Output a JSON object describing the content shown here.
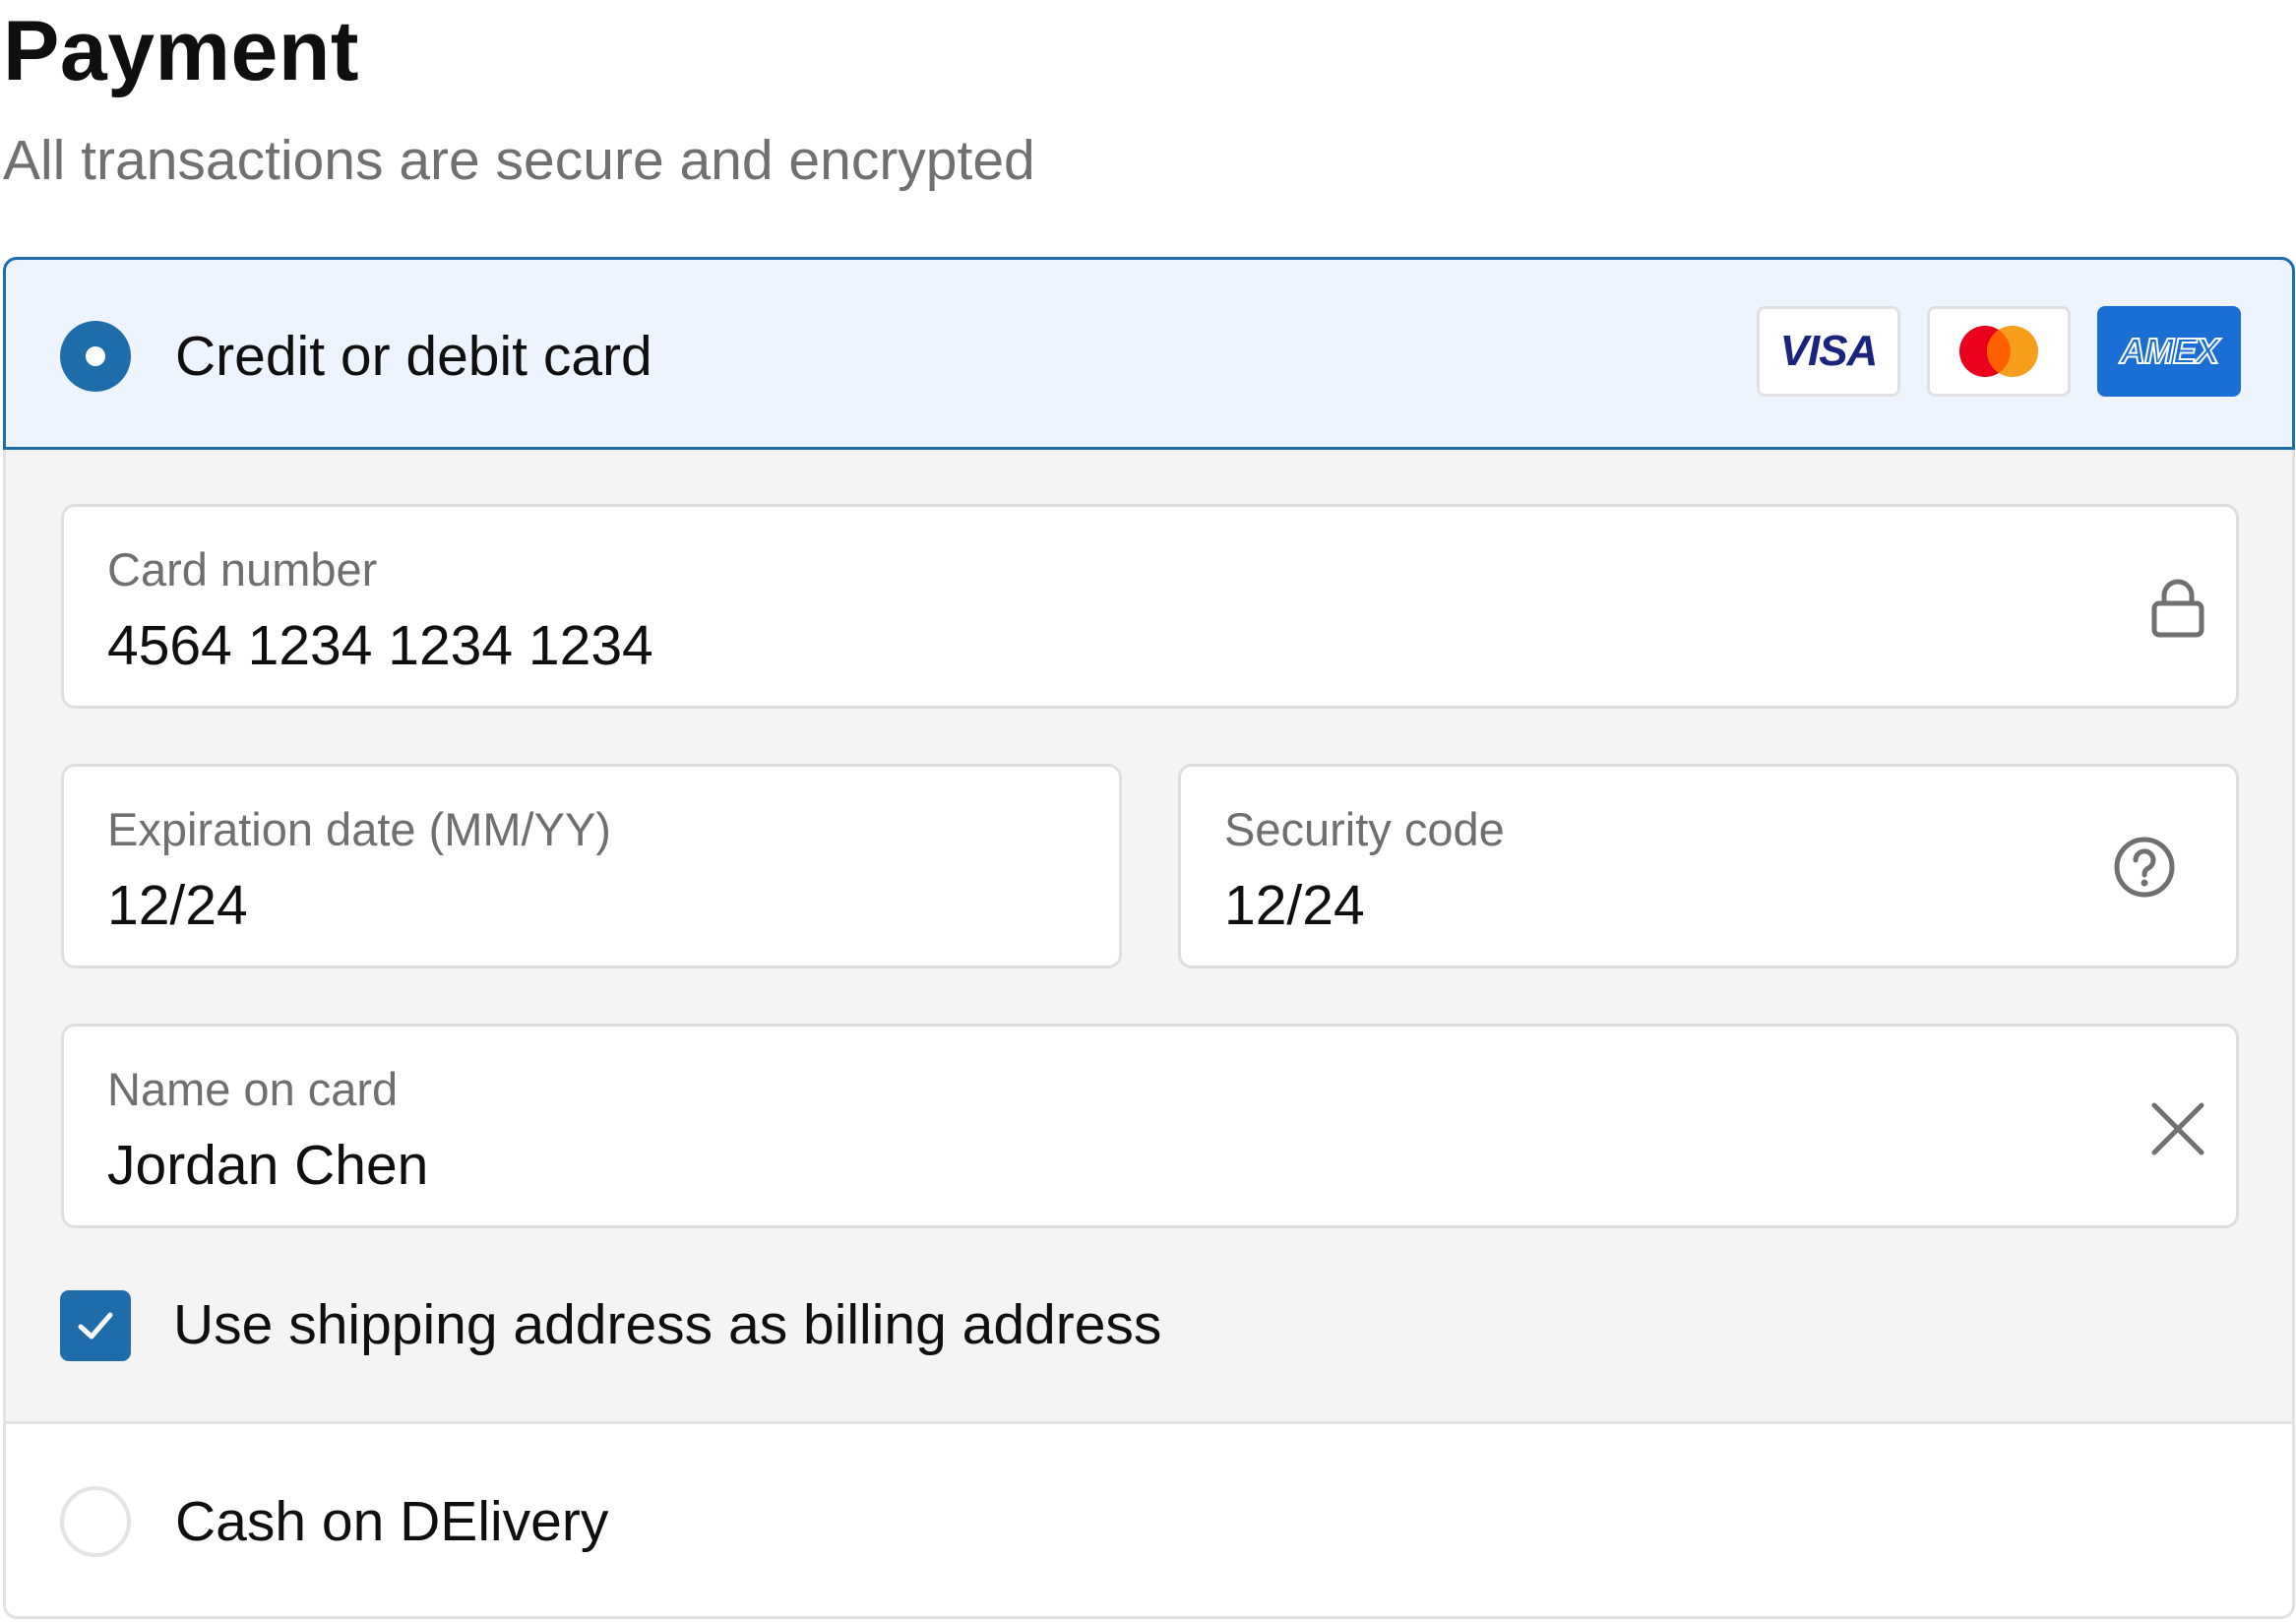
{
  "header": {
    "title": "Payment",
    "subtitle": "All transactions are secure and encrypted"
  },
  "payment_options": [
    {
      "label": "Credit or debit card",
      "selected": true,
      "brands": [
        "VISA",
        "mastercard",
        "AMEX"
      ]
    },
    {
      "label": "Cash on DElivery",
      "selected": false
    }
  ],
  "card_form": {
    "card_number": {
      "label": "Card number",
      "value": "4564 1234 1234 1234",
      "icon": "lock-icon"
    },
    "expiration": {
      "label": "Expiration date (MM/YY)",
      "value": "12/24"
    },
    "security_code": {
      "label": "Security code",
      "value": "12/24",
      "icon": "help-circle-icon"
    },
    "name_on_card": {
      "label": "Name on card",
      "value": "Jordan Chen",
      "icon": "clear-icon"
    },
    "billing_checkbox": {
      "label": "Use shipping address as billing address",
      "checked": true
    }
  },
  "colors": {
    "accent": "#1f6cab",
    "selected_bg": "#edf4fd",
    "form_bg": "#f4f4f4",
    "amex": "#1a6fd4",
    "visa": "#1a237e",
    "mastercard_red": "#eb001b",
    "mastercard_orange": "#f79e1b"
  }
}
